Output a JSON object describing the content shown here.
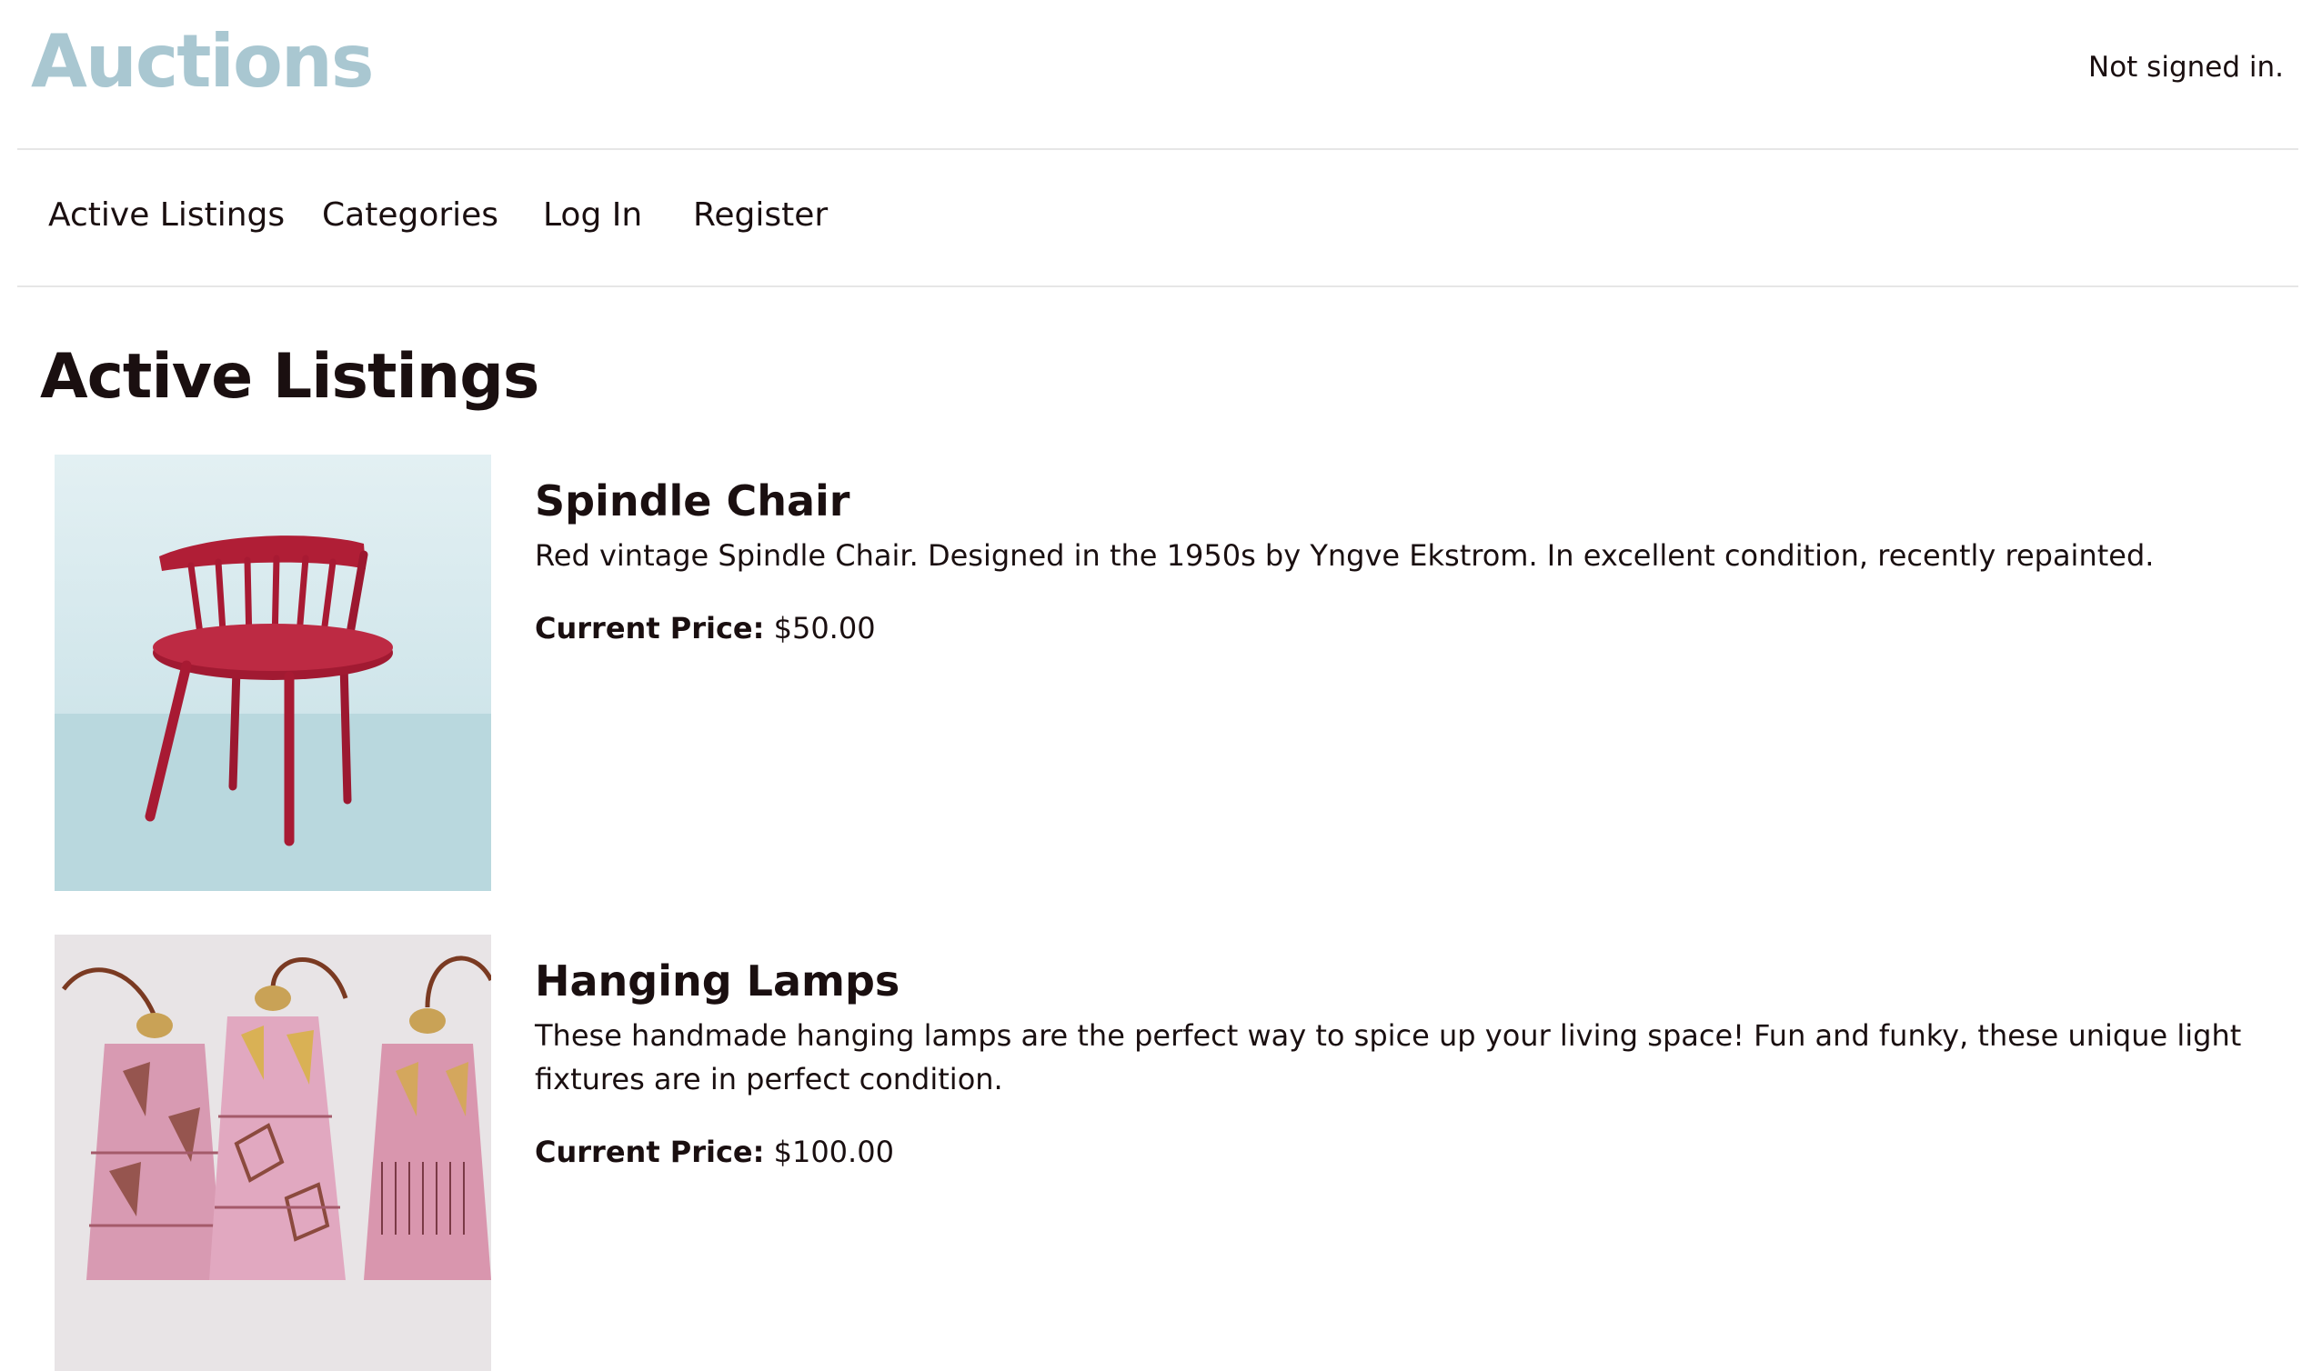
{
  "header": {
    "logo_text": "Auctions",
    "signin_status": "Not signed in."
  },
  "nav": {
    "items": [
      {
        "label": "Active Listings"
      },
      {
        "label": "Categories"
      },
      {
        "label": "Log In"
      },
      {
        "label": "Register"
      }
    ]
  },
  "main": {
    "page_title": "Active Listings",
    "listings": [
      {
        "title": "Spindle Chair",
        "description": "Red vintage Spindle Chair. Designed in the 1950s by Yngve Ekstrom. In excellent condition, recently repainted.",
        "price_label": "Current Price:",
        "price_value": "$50.00",
        "image_icon": "red-spindle-chair"
      },
      {
        "title": "Hanging Lamps",
        "description": "These handmade hanging lamps are the perfect way to spice up your living space! Fun and funky, these unique light fixtures are in perfect condition.",
        "price_label": "Current Price:",
        "price_value": "$100.00",
        "image_icon": "pink-ceramic-hanging-lamps"
      }
    ]
  },
  "colors": {
    "logo": "#a9c7d1",
    "text": "#1a0f10",
    "divider": "#e6e6e6",
    "chair_red": "#b5203a",
    "chair_bg": "#cfe6ea",
    "lamp_pink": "#d89ab2"
  }
}
